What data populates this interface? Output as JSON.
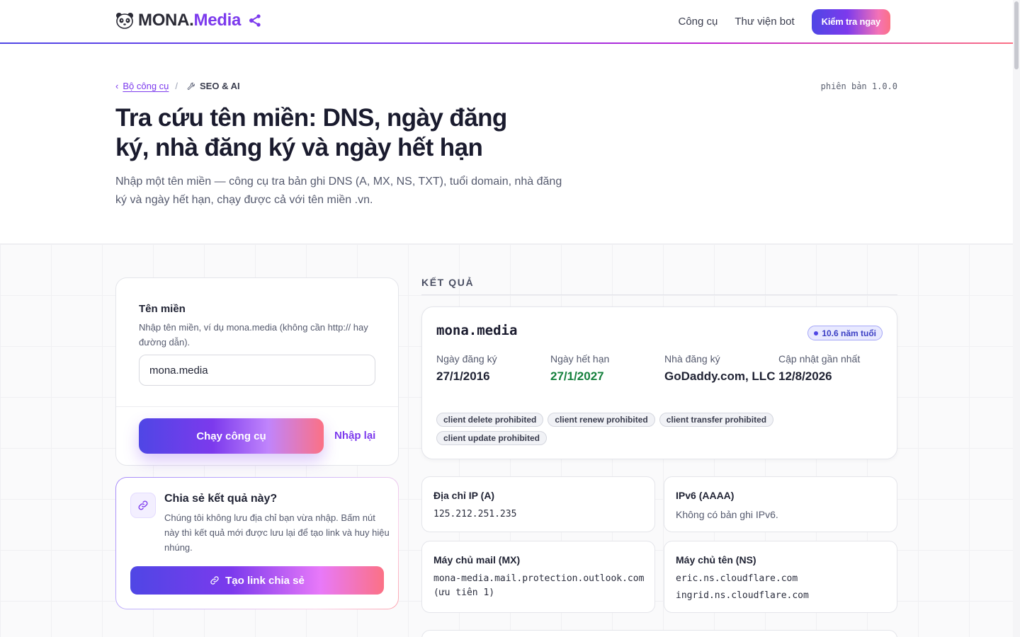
{
  "header": {
    "logo_prefix": "MONA.",
    "logo_accent": "Media",
    "nav": [
      {
        "label": "Công cụ"
      },
      {
        "label": "Thư viện bot"
      }
    ],
    "cta_label": "Kiểm tra ngay"
  },
  "breadcrumb": {
    "back_label": "Bộ công cụ",
    "current_label": "SEO & AI"
  },
  "version": "phiên bản 1.0.0",
  "hero": {
    "title": "Tra cứu tên miền: DNS, ngày đăng ký, nhà đăng ký và ngày hết hạn",
    "description": "Nhập một tên miền — công cụ tra bản ghi DNS (A, MX, NS, TXT), tuổi domain, nhà đăng ký và ngày hết hạn, chạy được cả với tên miền .vn."
  },
  "form": {
    "label": "Tên miền",
    "hint": "Nhập tên miền, ví dụ mona.media (không cần http:// hay đường dẫn).",
    "value": "mona.media",
    "run_label": "Chạy công cụ",
    "reset_label": "Nhập lại"
  },
  "share": {
    "title": "Chia sẻ kết quả này?",
    "description": "Chúng tôi không lưu địa chỉ bạn vừa nhập. Bấm nút này thì kết quả mới được lưu lại để tạo link và huy hiệu nhúng.",
    "button_label": "Tạo link chia sẻ"
  },
  "results": {
    "section_label": "KẾT QUẢ",
    "whois": {
      "domain": "mona.media",
      "age_badge": "10.6 năm tuổi",
      "fields": [
        {
          "key": "Ngày đăng ký",
          "value": "27/1/2016"
        },
        {
          "key": "Ngày hết hạn",
          "value": "27/1/2027"
        },
        {
          "key": "Nhà đăng ký",
          "value": "GoDaddy.com, LLC"
        },
        {
          "key": "Cập nhật gần nhất",
          "value": "12/8/2026"
        }
      ],
      "statuses": [
        "client delete prohibited",
        "client renew prohibited",
        "client transfer prohibited",
        "client update prohibited"
      ]
    },
    "records": {
      "a": {
        "title": "Địa chỉ IP (A)",
        "value": "125.212.251.235"
      },
      "aaaa": {
        "title": "IPv6 (AAAA)",
        "value": "Không có bản ghi IPv6."
      },
      "mx": {
        "title": "Máy chủ mail (MX)",
        "value": "mona-media.mail.protection.outlook.com (ưu tiên 1)"
      },
      "ns": {
        "title": "Máy chủ tên (NS)",
        "values": [
          "eric.ns.cloudflare.com",
          "ingrid.ns.cloudflare.com"
        ]
      }
    }
  },
  "colors": {
    "accent": "#7c3aed",
    "primary": "#4f46e5",
    "gradient_end": "#fb7185",
    "expiry_green": "#15803d"
  }
}
